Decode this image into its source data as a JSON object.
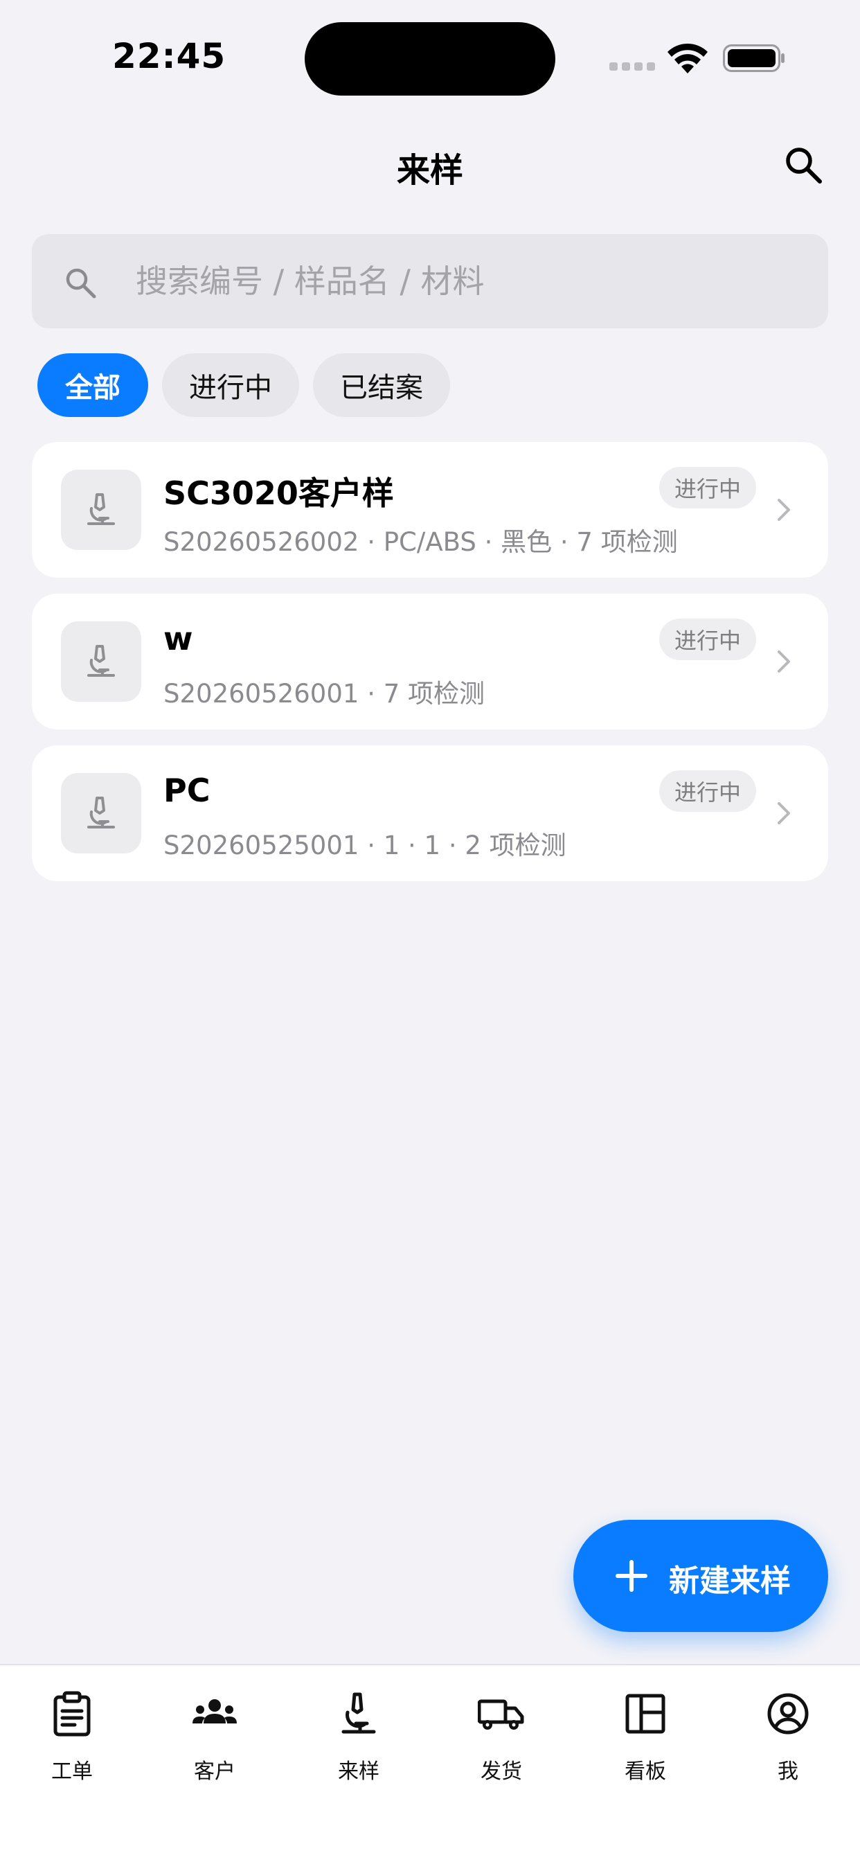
{
  "status_bar": {
    "time": "22:45"
  },
  "nav": {
    "title": "来样"
  },
  "search": {
    "placeholder": "搜索编号 / 样品名 / 材料"
  },
  "filters": [
    {
      "label": "全部",
      "active": true
    },
    {
      "label": "进行中",
      "active": false
    },
    {
      "label": "已结案",
      "active": false
    }
  ],
  "samples": [
    {
      "title": "SC3020客户样",
      "subtitle": "S20260526002 · PC/ABS · 黑色 · 7 项检测",
      "status": "进行中"
    },
    {
      "title": "w",
      "subtitle": "S20260526001 · 7 项检测",
      "status": "进行中"
    },
    {
      "title": "PC",
      "subtitle": "S20260525001 · 1 · 1 · 2 项检测",
      "status": "进行中"
    }
  ],
  "fab": {
    "label": "新建来样"
  },
  "tabs": [
    {
      "label": "工单",
      "icon": "clipboard-icon"
    },
    {
      "label": "客户",
      "icon": "people-icon"
    },
    {
      "label": "来样",
      "icon": "microscope-icon"
    },
    {
      "label": "发货",
      "icon": "truck-icon"
    },
    {
      "label": "看板",
      "icon": "dashboard-icon"
    },
    {
      "label": "我",
      "icon": "account-icon"
    }
  ],
  "colors": {
    "accent": "#0a7cff",
    "background": "#f2f2f7",
    "badge_bg": "#eeeef0",
    "muted_text": "#8a8a8f"
  }
}
